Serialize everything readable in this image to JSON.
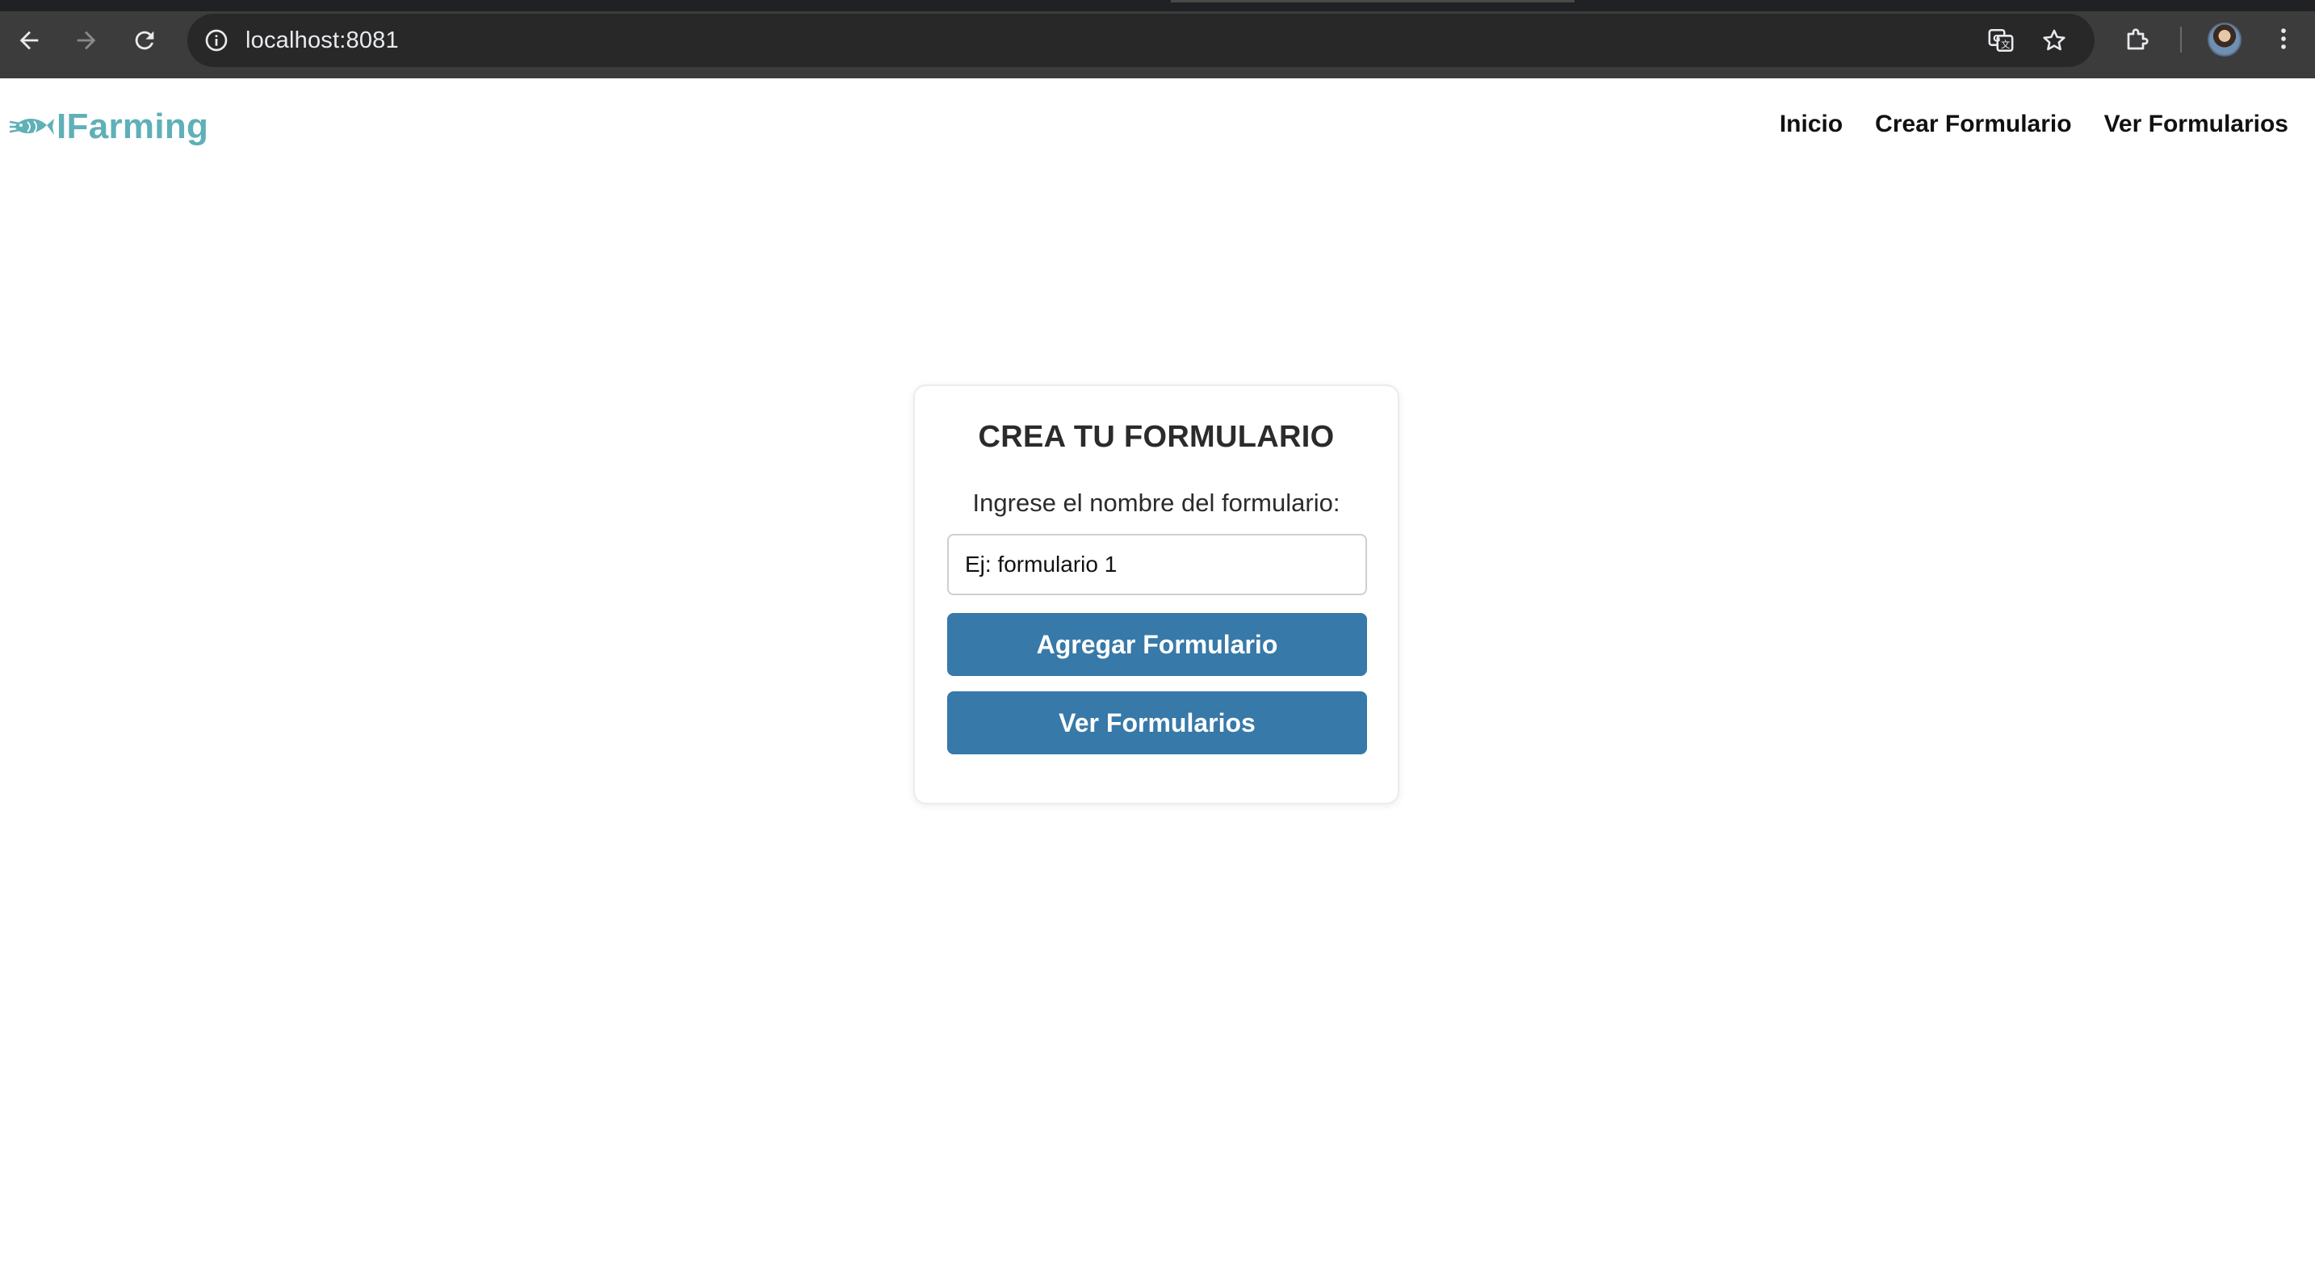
{
  "browser": {
    "url": "localhost:8081",
    "icons": {
      "back": "back-arrow-icon",
      "forward": "forward-arrow-icon",
      "reload": "reload-icon",
      "site_info": "info-icon",
      "translate": "translate-icon",
      "bookmark": "star-icon",
      "extensions": "puzzle-icon",
      "profile": "avatar",
      "menu": "kebab-menu-icon"
    }
  },
  "header": {
    "brand": "IFarming",
    "brand_color": "#5fb0b7",
    "nav": [
      {
        "label": "Inicio"
      },
      {
        "label": "Crear Formulario"
      },
      {
        "label": "Ver Formularios"
      }
    ]
  },
  "card": {
    "title": "CREA TU FORMULARIO",
    "label": "Ingrese el nombre del formulario:",
    "input_placeholder": "Ej: formulario 1",
    "add_button": "Agregar Formulario",
    "view_button": "Ver Formularios",
    "button_color": "#3779a8"
  }
}
